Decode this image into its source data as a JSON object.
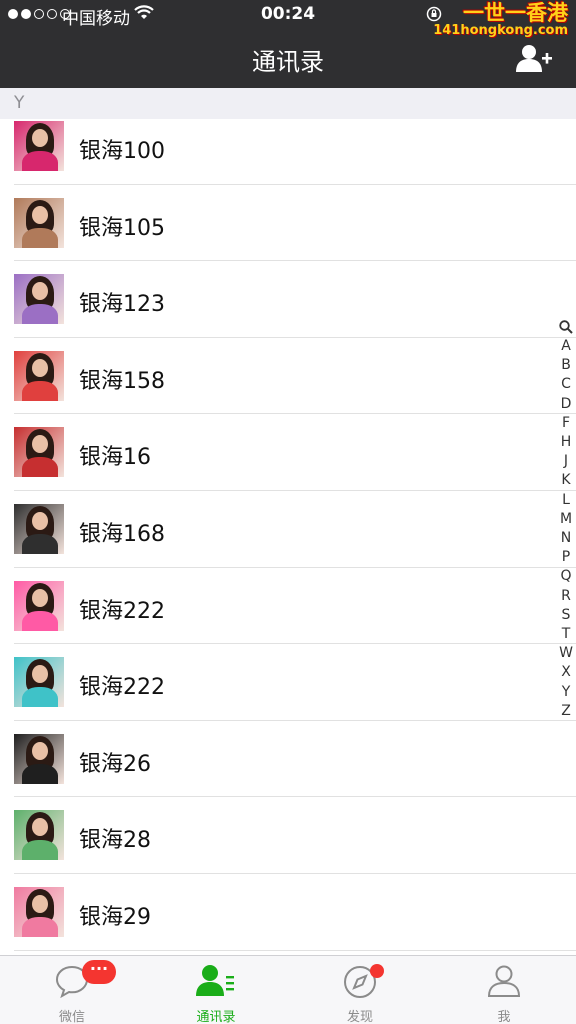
{
  "status_bar": {
    "carrier": "中国移动",
    "time": "00:24",
    "watermark_cn": "一世一香港",
    "watermark_en": "141hongkong.com"
  },
  "nav": {
    "title": "通讯录",
    "add_contact_icon": "add-person-icon"
  },
  "section": {
    "letter": "Y"
  },
  "contacts": [
    {
      "name": "银海100",
      "avatar_color": "#d7276d"
    },
    {
      "name": "银海105",
      "avatar_color": "#b07a5a"
    },
    {
      "name": "银海123",
      "avatar_color": "#9b6fc4"
    },
    {
      "name": "银海158",
      "avatar_color": "#e0403e"
    },
    {
      "name": "银海16",
      "avatar_color": "#c62f30"
    },
    {
      "name": "银海168",
      "avatar_color": "#2f2f2f"
    },
    {
      "name": "银海222",
      "avatar_color": "#ff5aa5"
    },
    {
      "name": "银海222",
      "avatar_color": "#3fc2c8"
    },
    {
      "name": "银海26",
      "avatar_color": "#1f1f1f"
    },
    {
      "name": "银海28",
      "avatar_color": "#5db06b"
    },
    {
      "name": "银海29",
      "avatar_color": "#f07aa0"
    }
  ],
  "index_bar": [
    "A",
    "B",
    "C",
    "D",
    "F",
    "H",
    "J",
    "K",
    "L",
    "M",
    "N",
    "P",
    "Q",
    "R",
    "S",
    "T",
    "W",
    "X",
    "Y",
    "Z"
  ],
  "tabs": [
    {
      "label": "微信",
      "icon": "chat-bubble-icon",
      "badge": "···"
    },
    {
      "label": "通讯录",
      "icon": "contacts-icon",
      "active": true
    },
    {
      "label": "发现",
      "icon": "compass-icon"
    },
    {
      "label": "我",
      "icon": "person-icon"
    }
  ],
  "colors": {
    "accent": "#1aad19",
    "badge": "#f43530",
    "nav_bg": "#2f2f31"
  }
}
